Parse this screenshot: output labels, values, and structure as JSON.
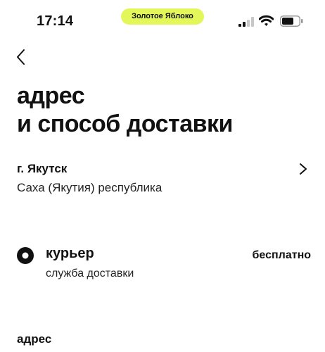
{
  "status_bar": {
    "time": "17:14",
    "app_badge": "Золотое Яблоко",
    "icons": [
      "signal-icon",
      "wifi-icon",
      "battery-icon"
    ]
  },
  "nav": {
    "back_icon": "chevron-left-icon"
  },
  "header": {
    "title_line1": "адрес",
    "title_line2": "и способ доставки"
  },
  "address": {
    "city": "г. Якутск",
    "region": "Саха (Якутия) республика",
    "icon": "chevron-right-icon"
  },
  "delivery": {
    "selected": true,
    "label": "курьер",
    "sublabel": "служба доставки",
    "price": "бесплатно"
  },
  "section": {
    "address_label": "адрес"
  },
  "colors": {
    "accent": "#e3f75a",
    "text": "#111111",
    "background": "#ffffff"
  }
}
